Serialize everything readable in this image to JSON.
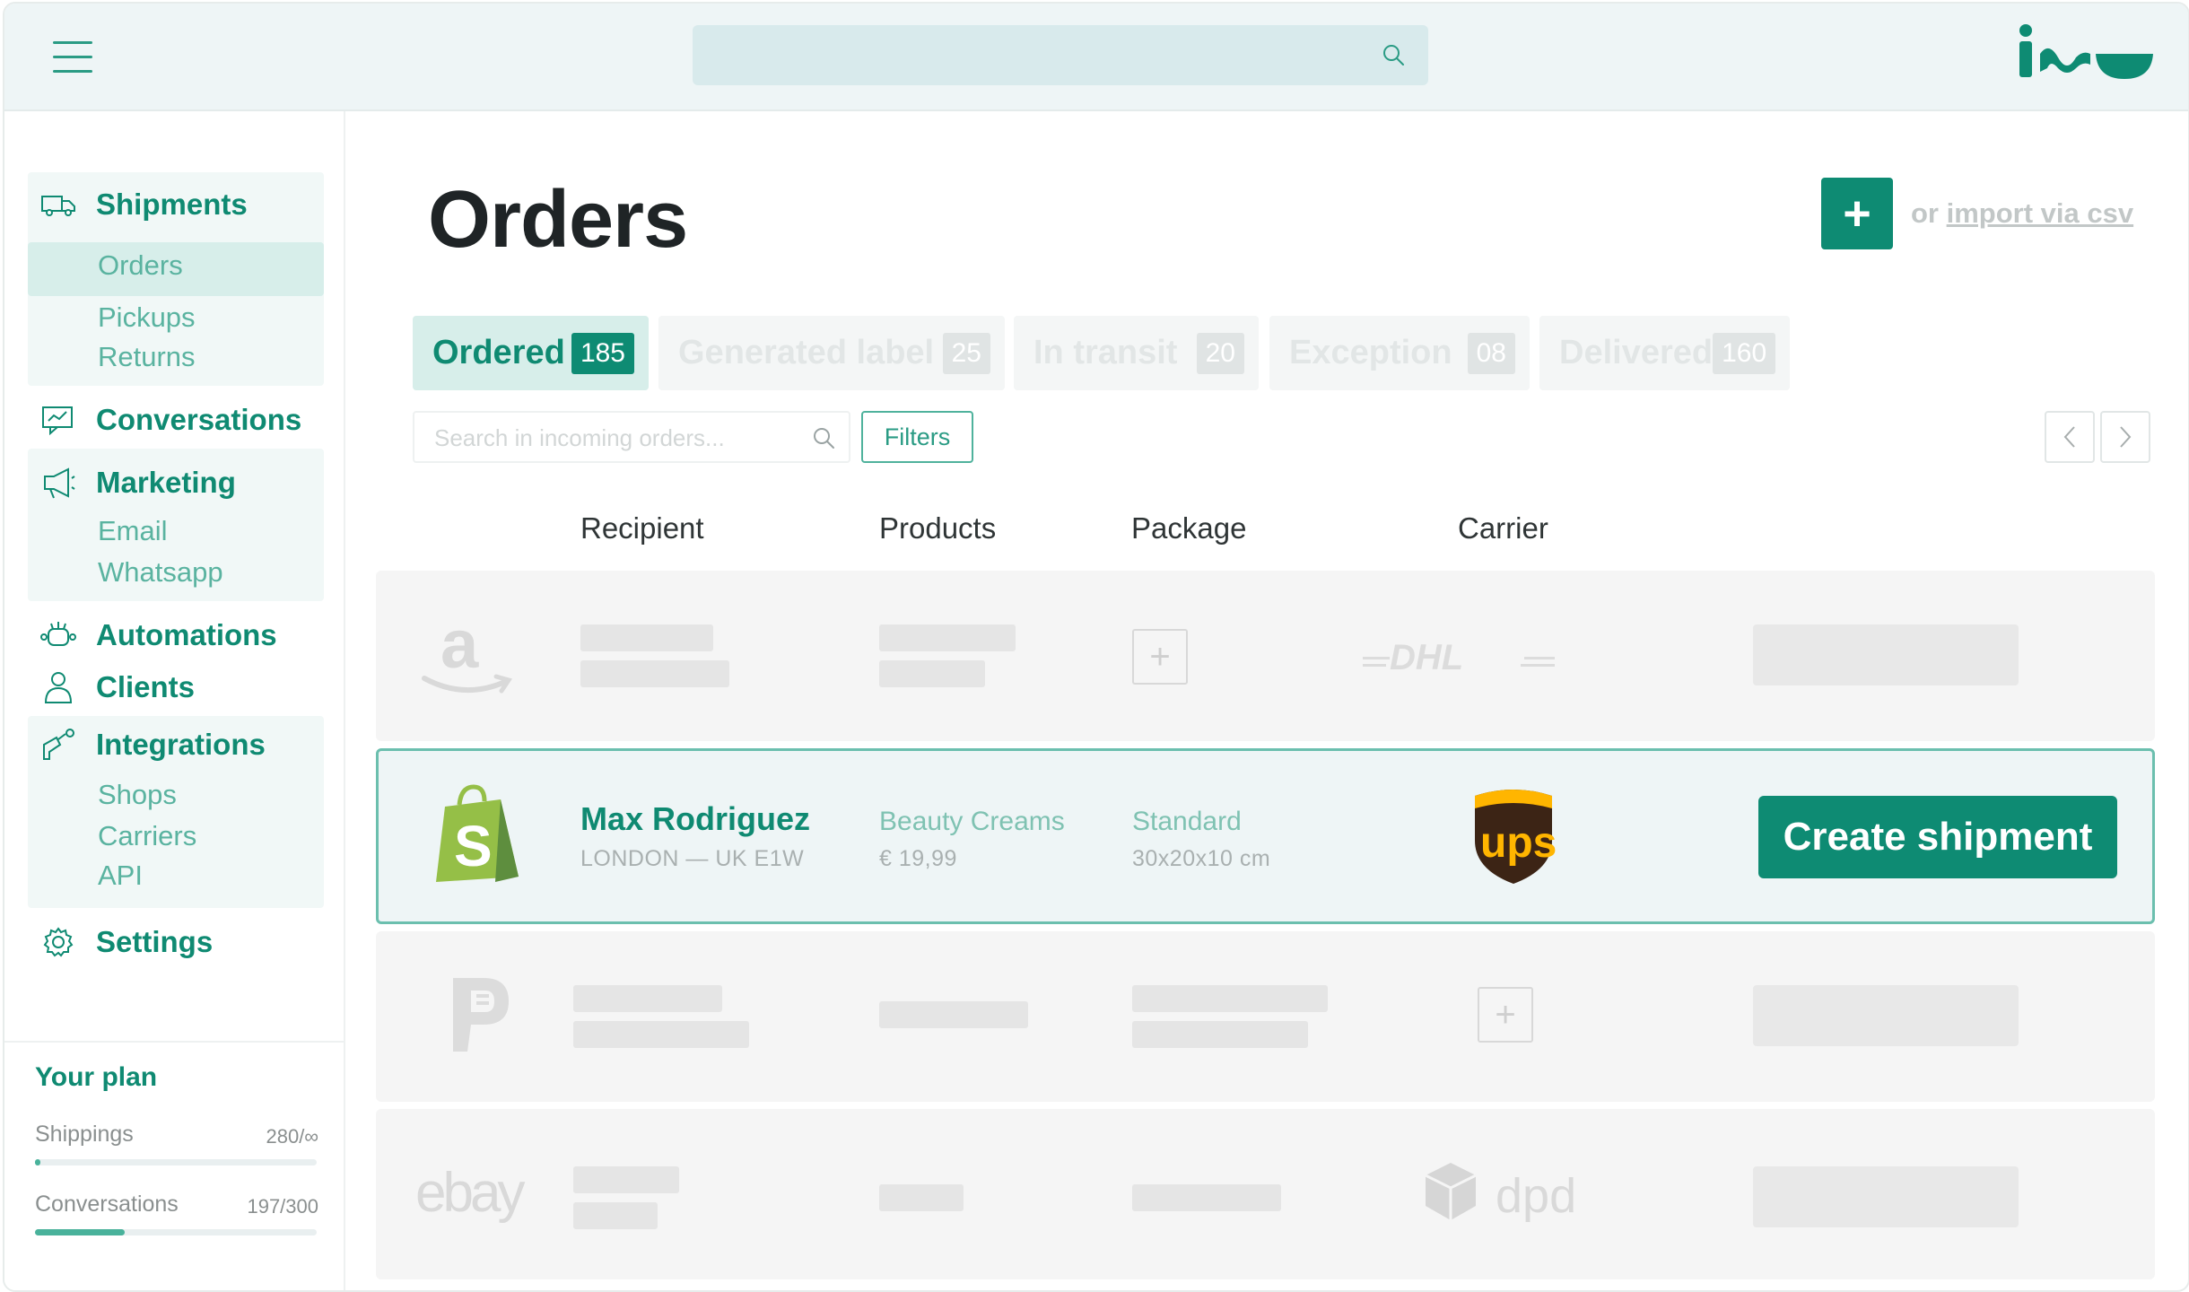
{
  "header": {
    "search_placeholder": ""
  },
  "sidebar": {
    "groups": [
      {
        "label": "Shipments",
        "icon": "truck-icon",
        "items": [
          "Orders",
          "Pickups",
          "Returns"
        ],
        "active": "Orders"
      },
      {
        "label": "Conversations",
        "icon": "chat-icon",
        "items": []
      },
      {
        "label": "Marketing",
        "icon": "megaphone-icon",
        "items": [
          "Email",
          "Whatsapp"
        ]
      },
      {
        "label": "Automations",
        "icon": "robot-icon",
        "items": []
      },
      {
        "label": "Clients",
        "icon": "user-icon",
        "items": []
      },
      {
        "label": "Integrations",
        "icon": "plug-icon",
        "items": [
          "Shops",
          "Carriers",
          "API"
        ]
      },
      {
        "label": "Settings",
        "icon": "gear-icon",
        "items": []
      }
    ],
    "plan": {
      "title": "Your plan",
      "rows": [
        {
          "label": "Shippings",
          "value": "280/∞",
          "fill": 0.02
        },
        {
          "label": "Conversations",
          "value": "197/300",
          "fill": 0.32
        }
      ]
    }
  },
  "main": {
    "title": "Orders",
    "add_label": "+",
    "import_prefix": "or ",
    "import_link": "import via csv",
    "tabs": [
      {
        "label": "Ordered",
        "count": "185",
        "active": true
      },
      {
        "label": "Generated label",
        "count": "25",
        "active": false
      },
      {
        "label": "In transit",
        "count": "20",
        "active": false
      },
      {
        "label": "Exception",
        "count": "08",
        "active": false
      },
      {
        "label": "Delivered",
        "count": "160",
        "active": false
      }
    ],
    "search_placeholder": "Search in incoming orders...",
    "filters_label": "Filters",
    "columns": [
      "Recipient",
      "Products",
      "Package",
      "Carrier"
    ],
    "selected_order": {
      "shop": "shopify-logo",
      "recipient_name": "Max Rodriguez",
      "recipient_address": "LONDON — UK E1W",
      "product_name": "Beauty Creams",
      "product_price": "€ 19,99",
      "package_type": "Standard",
      "package_dims": "30x20x10 cm",
      "carrier": "ups-logo",
      "action_label": "Create shipment"
    },
    "placeholder_rows": [
      {
        "shop": "amazon-logo",
        "carrier": "DHL"
      },
      {
        "shop": "paypal-logo",
        "carrier": ""
      },
      {
        "shop": "ebay",
        "carrier": "dpd"
      }
    ]
  },
  "colors": {
    "accent": "#0e8b73",
    "accent_light": "#d7eeea",
    "topbar": "#eef5f6"
  }
}
